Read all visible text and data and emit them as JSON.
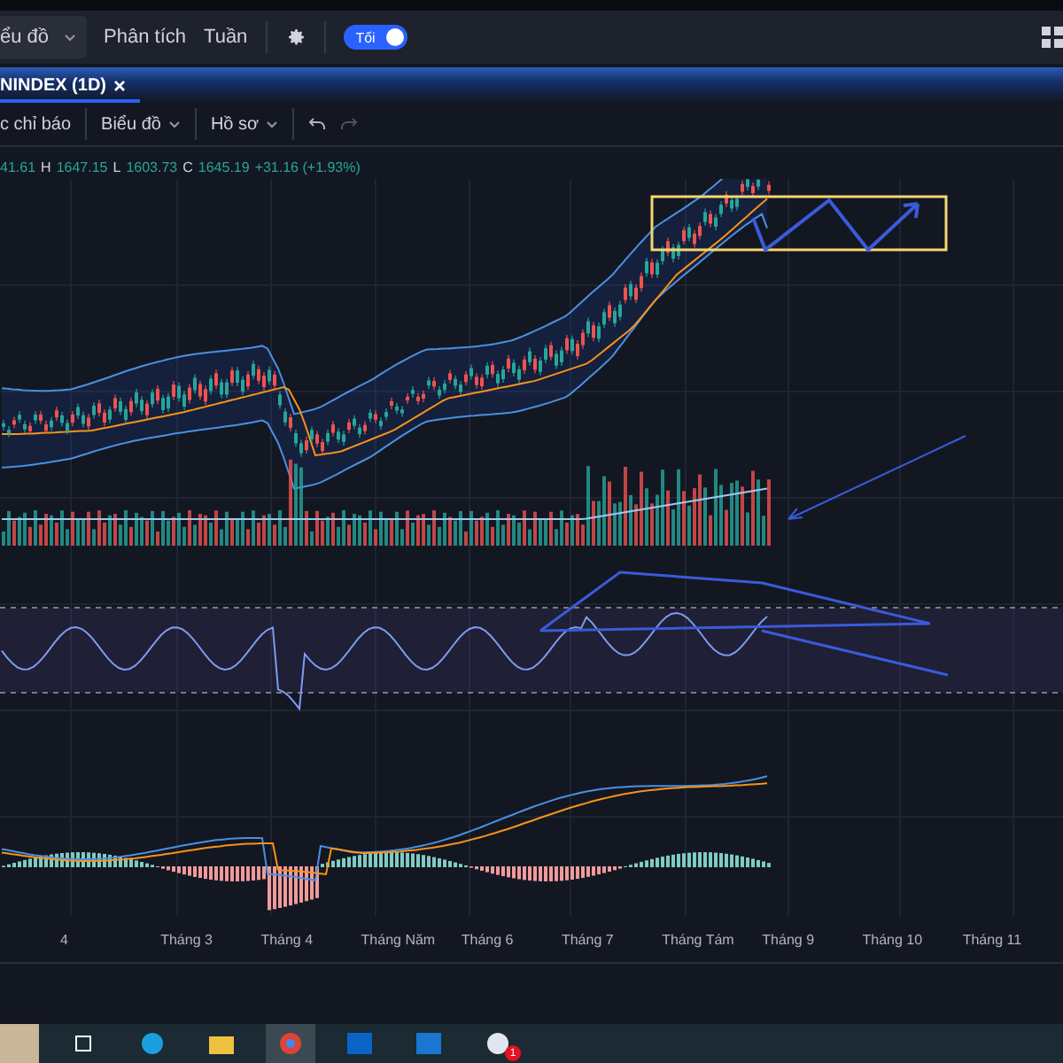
{
  "top_bar": {
    "chart_menu": "ểu đồ",
    "links": [
      "Phân tích",
      "Tuần"
    ],
    "theme_toggle": {
      "label": "Tối",
      "on": true
    }
  },
  "tab": {
    "label": "NINDEX (1D)",
    "selected": true
  },
  "toolbar": {
    "items": [
      "c chỉ báo",
      "Biểu đồ",
      "Hồ sơ"
    ]
  },
  "ohlc": {
    "open": "41.61",
    "high_label": "H",
    "high": "1647.15",
    "low_label": "L",
    "low": "1603.73",
    "close_label": "C",
    "close": "1645.19",
    "change": "+31.16 (+1.93%)"
  },
  "x_axis": [
    "4",
    "Tháng 3",
    "Tháng 4",
    "Tháng Năm",
    "Tháng 6",
    "Tháng 7",
    "Tháng Tám",
    "Tháng 9",
    "Tháng 10",
    "Tháng 11"
  ],
  "taskbar": {
    "badge": "1"
  }
}
